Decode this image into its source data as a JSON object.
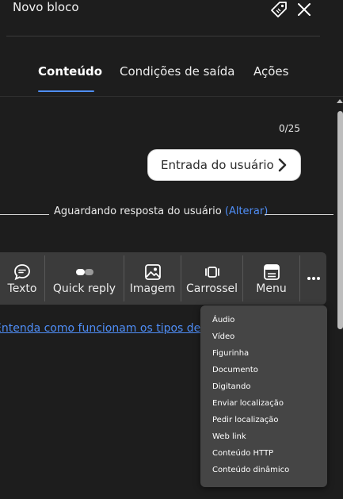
{
  "header": {
    "title": "Novo bloco",
    "tag_icon": "tag-icon",
    "close_icon": "close-icon"
  },
  "tabs": [
    {
      "label": "Conteúdo",
      "active": true
    },
    {
      "label": "Condições de saída",
      "active": false
    },
    {
      "label": "Ações",
      "active": false
    }
  ],
  "counter": "0/25",
  "user_input": {
    "label": "Entrada do usuário",
    "icon": "chevron-right-icon"
  },
  "waiting": {
    "text": "Aguardando resposta do usuário",
    "link": "(Alterar)"
  },
  "toolbar": {
    "items": [
      {
        "label": "Texto",
        "icon": "chat-bubble-icon"
      },
      {
        "label": "Quick reply",
        "icon": "quick-reply-icon"
      },
      {
        "label": "Imagem",
        "icon": "image-icon"
      },
      {
        "label": "Carrossel",
        "icon": "carousel-icon"
      },
      {
        "label": "Menu",
        "icon": "menu-icon"
      }
    ],
    "more_icon": "more-horizontal-icon"
  },
  "help_link": "Entenda como funcionam os tipos de conteúdo",
  "more_menu": {
    "items": [
      "Áudio",
      "Vídeo",
      "Figurinha",
      "Documento",
      "Digitando",
      "Enviar localização",
      "Pedir localização",
      "Web link",
      "Conteúdo HTTP",
      "Conteúdo dinâmico"
    ]
  },
  "colors": {
    "background": "#1d1d1d",
    "accent": "#4f8ef7",
    "toolbar": "#3b3b3b",
    "menu": "#454545"
  }
}
